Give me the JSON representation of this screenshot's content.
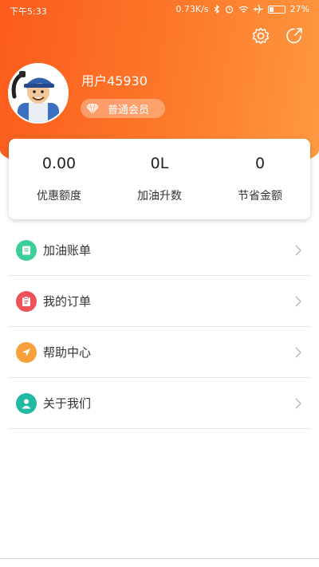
{
  "status_bar": {
    "time": "下午5:33",
    "network_speed": "0.73K/s",
    "battery": "27%"
  },
  "header": {
    "settings_icon": "gear-icon",
    "share_icon": "share-icon"
  },
  "profile": {
    "username": "用户45930",
    "member_level": "普通会员",
    "badge_icon": "diamond-icon"
  },
  "stats": [
    {
      "value": "0.00",
      "label": "优惠额度"
    },
    {
      "value": "0L",
      "label": "加油升数"
    },
    {
      "value": "0",
      "label": "节省金额"
    }
  ],
  "menu": [
    {
      "label": "加油账单",
      "icon": "bill-icon",
      "color": "#3dcf98"
    },
    {
      "label": "我的订单",
      "icon": "clipboard-icon",
      "color": "#ef5359"
    },
    {
      "label": "帮助中心",
      "icon": "navigation-icon",
      "color": "#f8a03b"
    },
    {
      "label": "关于我们",
      "icon": "person-icon",
      "color": "#22b8a4"
    }
  ],
  "colors": {
    "brand_orange": "#fb6a24",
    "divider": "#e6e6e6"
  }
}
